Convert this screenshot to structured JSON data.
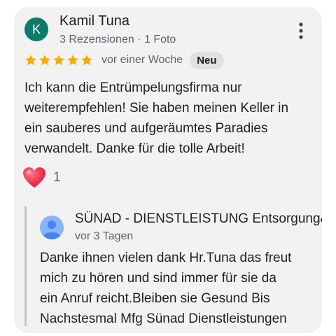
{
  "review": {
    "avatar_letter": "K",
    "avatar_color": "#0d7a6a",
    "author_name": "Kamil Tuna",
    "author_meta": "3 Rezensionen · 1 Foto",
    "more_icon": "more-vert-icon",
    "rating": 5,
    "rating_max": 5,
    "star_color": "#f9ab00",
    "date": "vor einer Woche",
    "badge": "Neu",
    "text": "Ich kann die Entrümpelungsfirma nur\nweiterempfehlen! Sie haben meinen Keller in\nein sauberes und aufgeräumtes Paradies\nverwandelt. Danke für die tolle Arbeit!",
    "reaction_icon": "heart-icon",
    "reaction_count": "1"
  },
  "reply": {
    "avatar_icon": "default-user-avatar-icon",
    "author_name": "SÜNAD - DIENSTLEISTUNG Entsorgung&Entrümpelung",
    "date": "vor 3 Tagen",
    "text": "Danke ihnen vielen dank Hr.Tuna das freut\nmich zu hören und sind immer für sie da\nein Anruf reicht.Bleiben sie Gesund Bis\nNachstesmal Mfg Sünad Dienstleistungen"
  }
}
